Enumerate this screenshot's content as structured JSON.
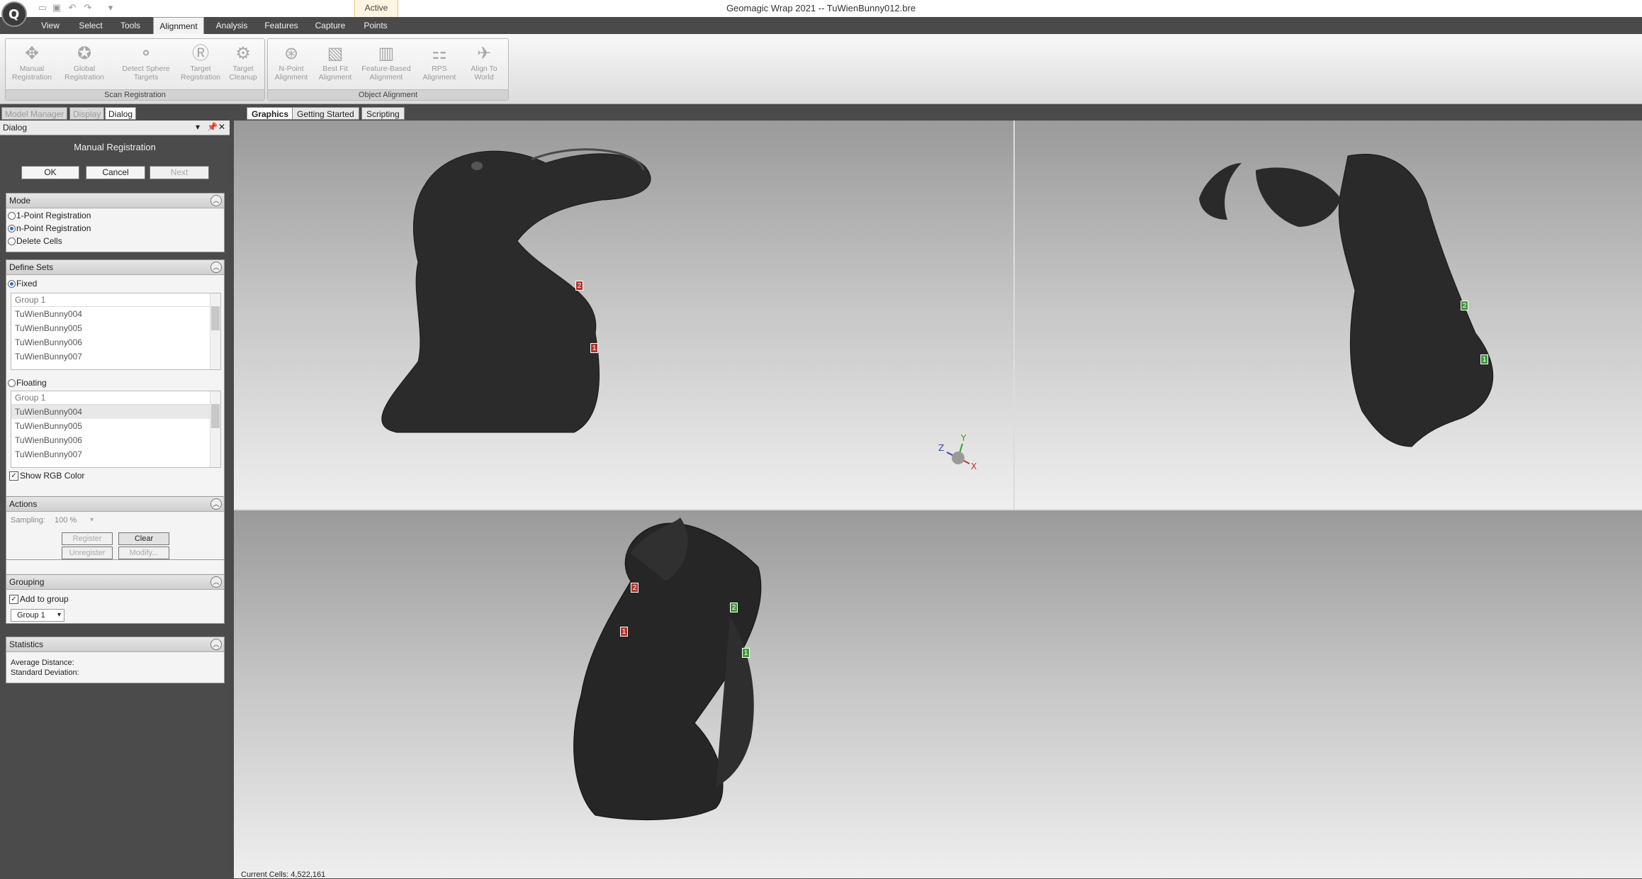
{
  "window": {
    "title": "Geomagic Wrap 2021 -- TuWienBunny012.bre",
    "active_label": "Active",
    "logo_letter": "Q"
  },
  "quick_access": [
    "new-icon",
    "save-icon",
    "undo-icon",
    "redo-icon",
    "dropdown-icon"
  ],
  "menu": {
    "tabs": [
      "View",
      "Select",
      "Tools",
      "Alignment",
      "Analysis",
      "Features",
      "Capture",
      "Points"
    ],
    "selected": "Alignment"
  },
  "ribbon": {
    "scan_registration": {
      "label": "Scan Registration",
      "buttons": [
        {
          "line1": "Manual",
          "line2": "Registration",
          "icon": "manual-registration-icon"
        },
        {
          "line1": "Global",
          "line2": "Registration",
          "icon": "global-registration-icon"
        },
        {
          "line1": "Detect Sphere",
          "line2": "Targets",
          "icon": "detect-sphere-targets-icon"
        },
        {
          "line1": "Target",
          "line2": "Registration",
          "icon": "target-registration-icon"
        },
        {
          "line1": "Target",
          "line2": "Cleanup",
          "icon": "target-cleanup-icon"
        }
      ]
    },
    "object_alignment": {
      "label": "Object Alignment",
      "buttons": [
        {
          "line1": "N-Point",
          "line2": "Alignment",
          "icon": "n-point-alignment-icon"
        },
        {
          "line1": "Best Fit",
          "line2": "Alignment",
          "icon": "best-fit-alignment-icon"
        },
        {
          "line1": "Feature-Based",
          "line2": "Alignment",
          "icon": "feature-based-alignment-icon"
        },
        {
          "line1": "RPS",
          "line2": "Alignment",
          "icon": "rps-alignment-icon"
        },
        {
          "line1": "Align To",
          "line2": "World",
          "icon": "align-to-world-icon"
        }
      ]
    }
  },
  "dock_tabs": [
    "Model Manager",
    "Display",
    "Dialog"
  ],
  "view_tabs": [
    "Graphics",
    "Getting Started",
    "Scripting"
  ],
  "panel": {
    "header": "Dialog",
    "dialog_title": "Manual Registration",
    "buttons": {
      "ok": "OK",
      "cancel": "Cancel",
      "next": "Next"
    },
    "mode": {
      "title": "Mode",
      "options": [
        "1-Point Registration",
        "n-Point Registration",
        "Delete Cells"
      ],
      "selected": "n-Point Registration"
    },
    "define_sets": {
      "title": "Define Sets",
      "fixed_label": "Fixed",
      "fixed_list": {
        "group": "Group 1",
        "items": [
          "TuWienBunny004",
          "TuWienBunny005",
          "TuWienBunny006",
          "TuWienBunny007"
        ]
      },
      "floating_label": "Floating",
      "floating_list": {
        "group": "Group 1",
        "items": [
          "TuWienBunny004",
          "TuWienBunny005",
          "TuWienBunny006",
          "TuWienBunny007"
        ]
      },
      "show_rgb": "Show RGB Color",
      "show_rgb_checked": true
    },
    "actions": {
      "title": "Actions",
      "sampling_label": "Sampling:",
      "sampling_value": "100 %",
      "register": "Register",
      "clear": "Clear",
      "unregister": "Unregister",
      "modify": "Modify..."
    },
    "grouping": {
      "title": "Grouping",
      "add_to_group": "Add to group",
      "add_checked": true,
      "group_value": "Group 1"
    },
    "statistics": {
      "title": "Statistics",
      "avg_label": "Average Distance:",
      "std_label": "Standard Deviation:"
    }
  },
  "viewports": {
    "fixed_markers": [
      "2",
      "1"
    ],
    "floating_markers": [
      "2",
      "1"
    ],
    "combined_markers": [
      "2",
      "1",
      "2",
      "1"
    ],
    "triad": {
      "x": "X",
      "y": "Y",
      "z": "Z"
    }
  },
  "status": "Current Cells: 4,522,161",
  "colors": {
    "marker_fixed": "#b3342b",
    "marker_floating": "#3e9a3a",
    "menu_bg": "#4a4a4a"
  }
}
